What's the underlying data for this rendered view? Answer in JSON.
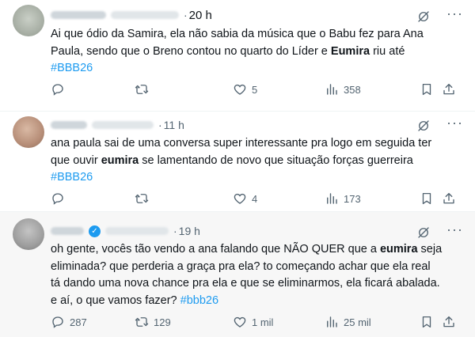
{
  "tweets": [
    {
      "time": "20 h",
      "text_parts": [
        "Ai que ódio da Samira, ela não sabia da música que o Babu fez para Ana\nPaula, sendo que o Breno contou no quarto do Líder e ",
        "Eumira",
        " riu até\n",
        "#BBB26"
      ],
      "replies": "",
      "retweets": "",
      "likes": "5",
      "views": "358"
    },
    {
      "time": "11 h",
      "text_parts": [
        "ana paula sai de uma conversa super interessante pra logo em seguida ter\nque ouvir ",
        "eumira",
        " se lamentando de novo que situação forças guerreira\n",
        "#BBB26"
      ],
      "replies": "",
      "retweets": "",
      "likes": "4",
      "views": "173"
    },
    {
      "time": "19 h",
      "text_parts": [
        "oh gente, vocês tão vendo a ana falando que NÃO QUER que a ",
        "eumira",
        " seja\neliminada? que perderia a graça pra ela? to começando achar que ela real\ntá dando uma nova chance pra ela e que se eliminarmos, ela ficará abalada.\ne aí, o que vamos fazer? ",
        "#bbb26"
      ],
      "replies": "287",
      "retweets": "129",
      "likes": "1 mil",
      "views": "25 mil"
    }
  ],
  "icons": {
    "reply": "reply-icon",
    "retweet": "retweet-icon",
    "like": "heart-icon",
    "views": "views-icon",
    "bookmark": "bookmark-icon",
    "share": "share-icon",
    "grok": "grok-icon",
    "more": "more-icon",
    "verified": "verified-badge-icon"
  },
  "colors": {
    "accent": "#1d9bf0",
    "secondary_text": "#536471",
    "primary_text": "#0f1419",
    "highlight_bg": "#f7f7f7"
  }
}
